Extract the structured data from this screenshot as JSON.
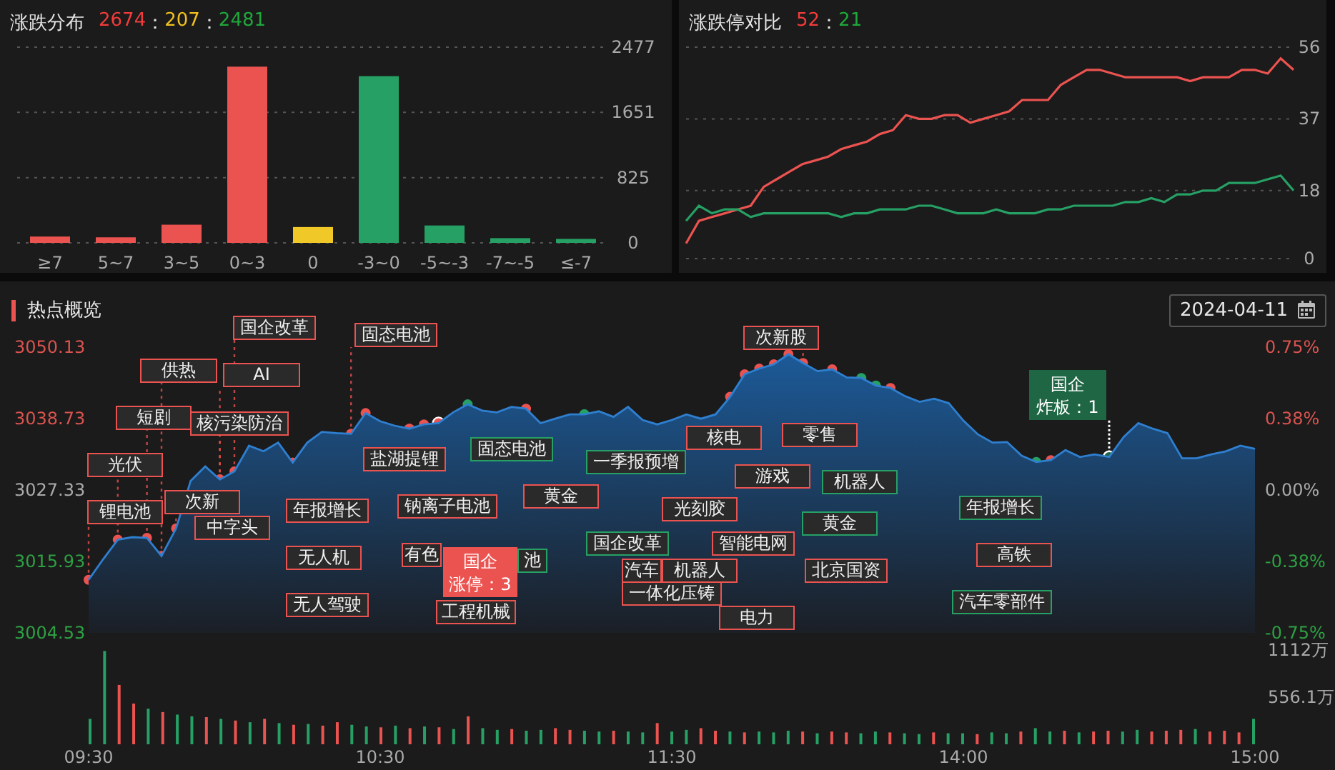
{
  "distribution": {
    "title": "涨跌分布",
    "summary": [
      {
        "kind": "up",
        "text": "2674"
      },
      {
        "kind": "sep",
        "text": "："
      },
      {
        "kind": "flat",
        "text": "207"
      },
      {
        "kind": "sep",
        "text": "："
      },
      {
        "kind": "down",
        "text": "2481"
      }
    ],
    "chart_data": {
      "type": "bar",
      "stacked": true,
      "categories": [
        "≥7",
        "5~7",
        "3~5",
        "0~3",
        "0",
        "-3~0",
        "-5~-3",
        "-7~-5",
        "≤-7"
      ],
      "ylim": [
        0,
        2477
      ],
      "yticks": [
        0,
        825,
        1651,
        2477
      ],
      "series": [
        {
          "color": "#eb5350",
          "values": [
            80,
            70,
            230,
            2230,
            null,
            null,
            null,
            null,
            null
          ]
        },
        {
          "color": "#f0c928",
          "values": [
            null,
            null,
            null,
            null,
            200,
            null,
            null,
            null,
            null
          ]
        },
        {
          "color": "#26a065",
          "values": [
            null,
            null,
            null,
            null,
            null,
            2110,
            220,
            60,
            50
          ]
        }
      ]
    }
  },
  "limit_compare": {
    "title": "涨跌停对比",
    "summary": [
      {
        "kind": "up",
        "text": "52"
      },
      {
        "kind": "sep",
        "text": "："
      },
      {
        "kind": "down",
        "text": "21"
      }
    ],
    "chart_data": {
      "type": "line",
      "ylim": [
        0,
        56
      ],
      "yticks": [
        0,
        18,
        37,
        56
      ],
      "series": [
        {
          "color": "#eb5350",
          "values": [
            4,
            10,
            11,
            12,
            13,
            14,
            19,
            21,
            23,
            25,
            26,
            27,
            29,
            30,
            31,
            33,
            34,
            38,
            37,
            37,
            38,
            38,
            36,
            37,
            38,
            39,
            42,
            42,
            42,
            46,
            48,
            50,
            50,
            49,
            48,
            48,
            48,
            48,
            48,
            47,
            48,
            48,
            48,
            50,
            50,
            49,
            53,
            50
          ]
        },
        {
          "color": "#26a065",
          "values": [
            10,
            14,
            12,
            13,
            13,
            11,
            12,
            12,
            12,
            12,
            12,
            12,
            11,
            12,
            12,
            13,
            13,
            13,
            14,
            14,
            13,
            12,
            12,
            12,
            13,
            12,
            12,
            12,
            13,
            13,
            14,
            14,
            14,
            14,
            15,
            15,
            16,
            15,
            17,
            17,
            18,
            18,
            20,
            20,
            20,
            21,
            22,
            18
          ]
        }
      ]
    }
  },
  "hotspots": {
    "title": "热点概览",
    "date": "2024-04-11",
    "index_chart": {
      "chart_data": {
        "type": "area",
        "ylim": [
          3004.53,
          3050.13
        ],
        "yticks": [
          3004.53,
          3015.93,
          3027.33,
          3038.73,
          3050.13
        ],
        "categories": [
          "09:30",
          null,
          null,
          null,
          null,
          null,
          null,
          null,
          null,
          null,
          null,
          null,
          null,
          null,
          null,
          null,
          null,
          null,
          null,
          null,
          "10:30",
          null,
          null,
          null,
          null,
          null,
          null,
          null,
          null,
          null,
          null,
          null,
          null,
          null,
          null,
          null,
          null,
          null,
          null,
          null,
          "11:30",
          null,
          null,
          null,
          null,
          null,
          null,
          null,
          null,
          null,
          null,
          null,
          null,
          null,
          null,
          null,
          null,
          null,
          null,
          null,
          "14:00",
          null,
          null,
          null,
          null,
          null,
          null,
          null,
          null,
          null,
          null,
          null,
          null,
          null,
          null,
          null,
          null,
          null,
          null,
          null,
          "15:00"
        ],
        "series": [
          {
            "color": "#2f7fd0",
            "values": [
              3013.0,
              3016.3,
              3019.4,
              3019.8,
              3019.7,
              3016.8,
              3021.2,
              3028.8,
              3031.1,
              3029.0,
              3030.3,
              3034.4,
              3033.5,
              3034.9,
              3031.7,
              3034.9,
              3036.6,
              3036.4,
              3036.3,
              3039.6,
              3038.3,
              3037.6,
              3037.1,
              3037.8,
              3038.0,
              3039.7,
              3041.0,
              3040.0,
              3039.7,
              3040.6,
              3040.3,
              3038.0,
              3038.7,
              3039.4,
              3039.4,
              3039.9,
              3039.0,
              3040.6,
              3038.5,
              3037.8,
              3038.5,
              3039.4,
              3038.7,
              3039.4,
              3042.2,
              3045.8,
              3046.7,
              3047.4,
              3049.0,
              3047.6,
              3046.3,
              3046.6,
              3045.3,
              3045.2,
              3044.0,
              3043.6,
              3042.3,
              3041.4,
              3041.9,
              3041.2,
              3038.4,
              3036.2,
              3034.9,
              3035.0,
              3032.8,
              3031.8,
              3032.1,
              3033.7,
              3032.6,
              3033.0,
              3032.6,
              3035.8,
              3038.0,
              3037.1,
              3036.4,
              3032.4,
              3032.4,
              3033.0,
              3033.5,
              3034.4,
              3033.9
            ]
          }
        ]
      },
      "pct_ticks": [
        "0.75%",
        "0.38%",
        "0.00%",
        "-0.38%",
        "-0.75%"
      ]
    },
    "tags": [
      {
        "text": "国企改革",
        "color": "#eb5350"
      },
      {
        "text": "固态电池",
        "color": "#eb5350"
      },
      {
        "text": "供热",
        "color": "#eb5350"
      },
      {
        "text": "AI",
        "color": "#eb5350"
      },
      {
        "text": "次新股",
        "color": "#eb5350"
      },
      {
        "text": "短剧",
        "color": "#eb5350"
      },
      {
        "text": "核污染防治",
        "color": "#eb5350"
      },
      {
        "text": "核电",
        "color": "#eb5350"
      },
      {
        "text": "零售",
        "color": "#eb5350"
      },
      {
        "text": "光伏",
        "color": "#eb5350"
      },
      {
        "text": "盐湖提锂",
        "color": "#eb5350"
      },
      {
        "text": "固态电池",
        "color": "#26a065"
      },
      {
        "text": "一季报预增",
        "color": "#26a065"
      },
      {
        "text": "次新",
        "color": "#eb5350"
      },
      {
        "text": "游戏",
        "color": "#eb5350"
      },
      {
        "text": "机器人",
        "color": "#26a065"
      },
      {
        "text": "锂电池",
        "color": "#eb5350"
      },
      {
        "text": "年报增长",
        "color": "#eb5350"
      },
      {
        "text": "钠离子电池",
        "color": "#eb5350"
      },
      {
        "text": "黄金",
        "color": "#eb5350"
      },
      {
        "text": "光刻胶",
        "color": "#eb5350"
      },
      {
        "text": "年报增长",
        "color": "#26a065"
      },
      {
        "text": "中字头",
        "color": "#eb5350"
      },
      {
        "text": "黄金",
        "color": "#26a065"
      },
      {
        "text": "国企改革",
        "color": "#26a065"
      },
      {
        "text": "智能电网",
        "color": "#eb5350"
      },
      {
        "text": "无人机",
        "color": "#eb5350"
      },
      {
        "text": "有色",
        "color": "#eb5350"
      },
      {
        "text": "池",
        "color": "#26a065"
      },
      {
        "text": "汽车",
        "color": "#eb5350"
      },
      {
        "text": "机器人",
        "color": "#eb5350"
      },
      {
        "text": "北京国资",
        "color": "#eb5350"
      },
      {
        "text": "高铁",
        "color": "#eb5350"
      },
      {
        "text": "无人驾驶",
        "color": "#eb5350"
      },
      {
        "text": "工程机械",
        "color": "#eb5350"
      },
      {
        "text": "一体化压铸",
        "color": "#eb5350"
      },
      {
        "text": "电力",
        "color": "#eb5350"
      },
      {
        "text": "汽车零部件",
        "color": "#26a065"
      }
    ],
    "tooltips": [
      {
        "title": "国企",
        "detail": "涨停：3",
        "color": "#eb5350"
      },
      {
        "title": "国企",
        "detail": "炸板：1",
        "color": "#1e6644"
      }
    ],
    "volume": {
      "chart_data": {
        "type": "bar",
        "stacked": true,
        "ylim": [
          0,
          1112
        ],
        "yticks": [
          {
            "value": 556.1,
            "label": "556.1万"
          },
          {
            "value": 1112,
            "label": "1112万"
          }
        ],
        "categories": [
          null,
          null,
          null,
          null,
          null,
          null,
          null,
          null,
          null,
          null,
          null,
          null,
          null,
          null,
          null,
          null,
          null,
          null,
          null,
          null,
          null,
          null,
          null,
          null,
          null,
          null,
          null,
          null,
          null,
          null,
          null,
          null,
          null,
          null,
          null,
          null,
          null,
          null,
          null,
          null,
          null,
          null,
          null,
          null,
          null,
          null,
          null,
          null,
          null,
          null,
          null,
          null,
          null,
          null,
          null,
          null,
          null,
          null,
          null,
          null,
          null,
          null,
          null,
          null,
          null,
          null,
          null,
          null,
          null,
          null,
          null,
          null,
          null,
          null,
          null,
          null,
          null,
          null,
          null,
          null,
          null
        ],
        "series": [
          {
            "color": "#eb5350",
            "values": [
              null,
              null,
              700,
              480,
              null,
              380,
              null,
              null,
              320,
              null,
              280,
              null,
              300,
              null,
              230,
              null,
              220,
              260,
              null,
              null,
              200,
              null,
              190,
              null,
              200,
              null,
              330,
              null,
              null,
              180,
              null,
              null,
              190,
              170,
              null,
              null,
              160,
              null,
              null,
              250,
              null,
              null,
              190,
              160,
              null,
              140,
              null,
              null,
              null,
              150,
              null,
              150,
              140,
              null,
              null,
              140,
              null,
              null,
              140,
              null,
              null,
              120,
              null,
              null,
              150,
              null,
              null,
              160,
              null,
              150,
              160,
              null,
              null,
              150,
              160,
              170,
              null,
              150,
              160,
              140,
              null
            ]
          },
          {
            "color": "#26a065",
            "values": [
              300,
              1100,
              null,
              null,
              420,
              null,
              350,
              330,
              null,
              300,
              null,
              260,
              null,
              250,
              null,
              240,
              null,
              null,
              230,
              210,
              null,
              220,
              null,
              210,
              null,
              180,
              null,
              190,
              170,
              null,
              160,
              170,
              null,
              null,
              160,
              150,
              null,
              150,
              140,
              null,
              150,
              170,
              null,
              null,
              150,
              null,
              150,
              140,
              160,
              null,
              130,
              null,
              null,
              130,
              150,
              null,
              130,
              120,
              null,
              130,
              130,
              null,
              140,
              130,
              null,
              190,
              150,
              null,
              140,
              null,
              null,
              150,
              170,
              null,
              null,
              null,
              180,
              null,
              null,
              null,
              300
            ]
          }
        ]
      }
    }
  }
}
